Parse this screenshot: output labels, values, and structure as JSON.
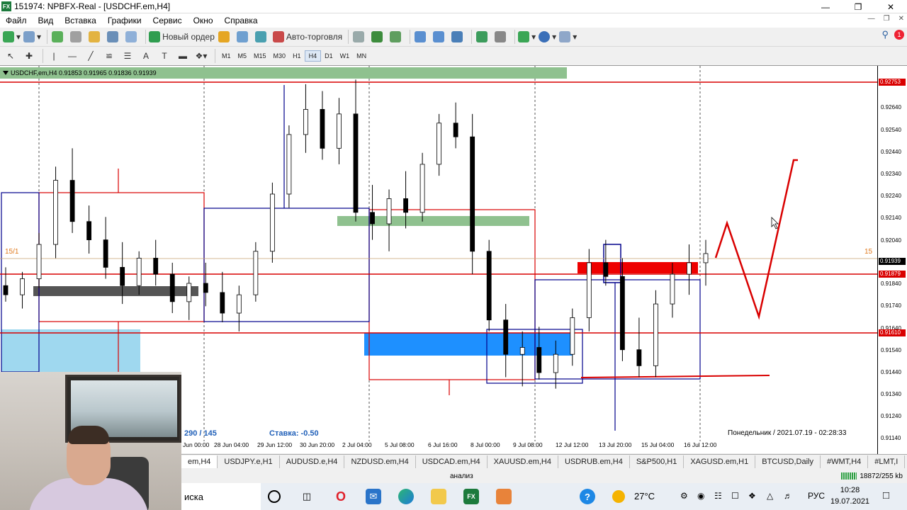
{
  "window": {
    "title": "151974: NPBFX-Real - [USDCHF.em,H4]",
    "app_icon": "FX"
  },
  "menu": [
    "Файл",
    "Вид",
    "Вставка",
    "Графики",
    "Сервис",
    "Окно",
    "Справка"
  ],
  "toolbar": {
    "new_order": "Новый ордер",
    "algo": "Авто-торговля"
  },
  "timeframes": [
    "M1",
    "M5",
    "M15",
    "M30",
    "H1",
    "H4",
    "D1",
    "W1",
    "MN"
  ],
  "active_timeframe": "H4",
  "notifications": "1",
  "chart": {
    "info": "USDCHF,em,H4  0.91853 0.91965 0.91836 0.91939",
    "stats": "290 / 145",
    "stake": "Ставка: -0.50",
    "server_time": "Понедельник  /  2021.07.19  -  02:28:33",
    "edge_left": "15/1",
    "edge_right": "15",
    "y_labels": [
      "0.92640",
      "0.92540",
      "0.92440",
      "0.92340",
      "0.92240",
      "0.92140",
      "0.92040",
      "0.91840",
      "0.91740",
      "0.91640",
      "0.91540",
      "0.91440",
      "0.91340",
      "0.91240",
      "0.91140"
    ],
    "tags": {
      "top": "0.92753",
      "price": "0.91939",
      "red": "0.91879",
      "bottom": "0.91610"
    },
    "x_labels": [
      "Jun 00:00",
      "28 Jun 04:00",
      "29 Jun 12:00",
      "30 Jun 20:00",
      "2 Jul 04:00",
      "5 Jul 08:00",
      "6 Jul 16:00",
      "8 Jul 00:00",
      "9 Jul 08:00",
      "12 Jul 12:00",
      "13 Jul 20:00",
      "15 Jul 04:00",
      "16 Jul 12:00"
    ]
  },
  "chart_data": {
    "type": "candlestick",
    "symbol": "USDCHF.em",
    "timeframe": "H4",
    "ylim": [
      0.9112,
      0.9276
    ],
    "last": {
      "open": 0.91853,
      "high": 0.91965,
      "low": 0.91836,
      "close": 0.91939
    },
    "levels": [
      0.92753,
      0.91879,
      0.9161
    ],
    "candles": [
      {
        "o": 0.918,
        "h": 0.9188,
        "l": 0.9173,
        "c": 0.9176
      },
      {
        "o": 0.9176,
        "h": 0.9186,
        "l": 0.917,
        "c": 0.9183
      },
      {
        "o": 0.9183,
        "h": 0.9203,
        "l": 0.9179,
        "c": 0.9198
      },
      {
        "o": 0.9198,
        "h": 0.9232,
        "l": 0.9192,
        "c": 0.9226
      },
      {
        "o": 0.9226,
        "h": 0.924,
        "l": 0.9203,
        "c": 0.9208
      },
      {
        "o": 0.9208,
        "h": 0.9215,
        "l": 0.9194,
        "c": 0.92
      },
      {
        "o": 0.92,
        "h": 0.921,
        "l": 0.9183,
        "c": 0.9188
      },
      {
        "o": 0.9188,
        "h": 0.9199,
        "l": 0.9172,
        "c": 0.918
      },
      {
        "o": 0.918,
        "h": 0.9195,
        "l": 0.9176,
        "c": 0.9192
      },
      {
        "o": 0.9192,
        "h": 0.92,
        "l": 0.918,
        "c": 0.9185
      },
      {
        "o": 0.9185,
        "h": 0.919,
        "l": 0.9168,
        "c": 0.9173
      },
      {
        "o": 0.9173,
        "h": 0.9184,
        "l": 0.9165,
        "c": 0.9181
      },
      {
        "o": 0.9181,
        "h": 0.919,
        "l": 0.9171,
        "c": 0.9177
      },
      {
        "o": 0.9177,
        "h": 0.9186,
        "l": 0.9164,
        "c": 0.9168
      },
      {
        "o": 0.9168,
        "h": 0.918,
        "l": 0.916,
        "c": 0.9176
      },
      {
        "o": 0.9176,
        "h": 0.9199,
        "l": 0.9173,
        "c": 0.9195
      },
      {
        "o": 0.9195,
        "h": 0.9225,
        "l": 0.919,
        "c": 0.922
      },
      {
        "o": 0.922,
        "h": 0.925,
        "l": 0.9214,
        "c": 0.9246
      },
      {
        "o": 0.9246,
        "h": 0.9268,
        "l": 0.9238,
        "c": 0.9257
      },
      {
        "o": 0.9257,
        "h": 0.9265,
        "l": 0.9235,
        "c": 0.924
      },
      {
        "o": 0.924,
        "h": 0.9262,
        "l": 0.9233,
        "c": 0.9255
      },
      {
        "o": 0.9255,
        "h": 0.927,
        "l": 0.9208,
        "c": 0.9212
      },
      {
        "o": 0.9212,
        "h": 0.9224,
        "l": 0.92,
        "c": 0.9207
      },
      {
        "o": 0.9207,
        "h": 0.9222,
        "l": 0.9195,
        "c": 0.9218
      },
      {
        "o": 0.9218,
        "h": 0.923,
        "l": 0.9205,
        "c": 0.9212
      },
      {
        "o": 0.9212,
        "h": 0.9238,
        "l": 0.9208,
        "c": 0.9233
      },
      {
        "o": 0.9233,
        "h": 0.9255,
        "l": 0.9228,
        "c": 0.9251
      },
      {
        "o": 0.9251,
        "h": 0.926,
        "l": 0.924,
        "c": 0.9245
      },
      {
        "o": 0.9245,
        "h": 0.9255,
        "l": 0.9185,
        "c": 0.9195
      },
      {
        "o": 0.9195,
        "h": 0.92,
        "l": 0.916,
        "c": 0.9165
      },
      {
        "o": 0.9165,
        "h": 0.9172,
        "l": 0.914,
        "c": 0.915
      },
      {
        "o": 0.915,
        "h": 0.916,
        "l": 0.9136,
        "c": 0.9153
      },
      {
        "o": 0.9153,
        "h": 0.9162,
        "l": 0.9139,
        "c": 0.9142
      },
      {
        "o": 0.9142,
        "h": 0.9156,
        "l": 0.9135,
        "c": 0.915
      },
      {
        "o": 0.915,
        "h": 0.917,
        "l": 0.9145,
        "c": 0.9166
      },
      {
        "o": 0.9166,
        "h": 0.9196,
        "l": 0.916,
        "c": 0.919
      },
      {
        "o": 0.919,
        "h": 0.92,
        "l": 0.918,
        "c": 0.9184
      },
      {
        "o": 0.9184,
        "h": 0.9192,
        "l": 0.9147,
        "c": 0.9152
      },
      {
        "o": 0.9152,
        "h": 0.9166,
        "l": 0.914,
        "c": 0.9145
      },
      {
        "o": 0.9145,
        "h": 0.9178,
        "l": 0.914,
        "c": 0.9172
      },
      {
        "o": 0.9172,
        "h": 0.919,
        "l": 0.9166,
        "c": 0.9185
      },
      {
        "o": 0.9185,
        "h": 0.9198,
        "l": 0.9176,
        "c": 0.919
      },
      {
        "o": 0.919,
        "h": 0.92,
        "l": 0.918,
        "c": 0.9194
      }
    ]
  },
  "tabs": [
    "em,H4",
    "USDJPY.e,H1",
    "AUDUSD.e,H4",
    "NZDUSD.em,H4",
    "USDCAD.em,H4",
    "XAUUSD.em,H4",
    "USDRUB.em,H4",
    "S&P500,H1",
    "XAGUSD.em,H1",
    "BTCUSD,Daily",
    "#WMT,H4",
    "#LMT,I"
  ],
  "active_tab": "em,H4",
  "status": {
    "analysis": "анализ",
    "bytes": "18872/255 kb"
  },
  "taskbar": {
    "search": "иска",
    "weather": "27°C",
    "lang": "РУС",
    "time": "10:28",
    "date": "19.07.2021"
  },
  "colors": {
    "bull": "#ffffff",
    "bear": "#000000",
    "level": "#d90000",
    "zone_green": "#8fc18f",
    "zone_blue": "#1e90ff",
    "zone_gray": "#555555",
    "zone_red": "#ee0000",
    "box_blue": "#00008b"
  }
}
